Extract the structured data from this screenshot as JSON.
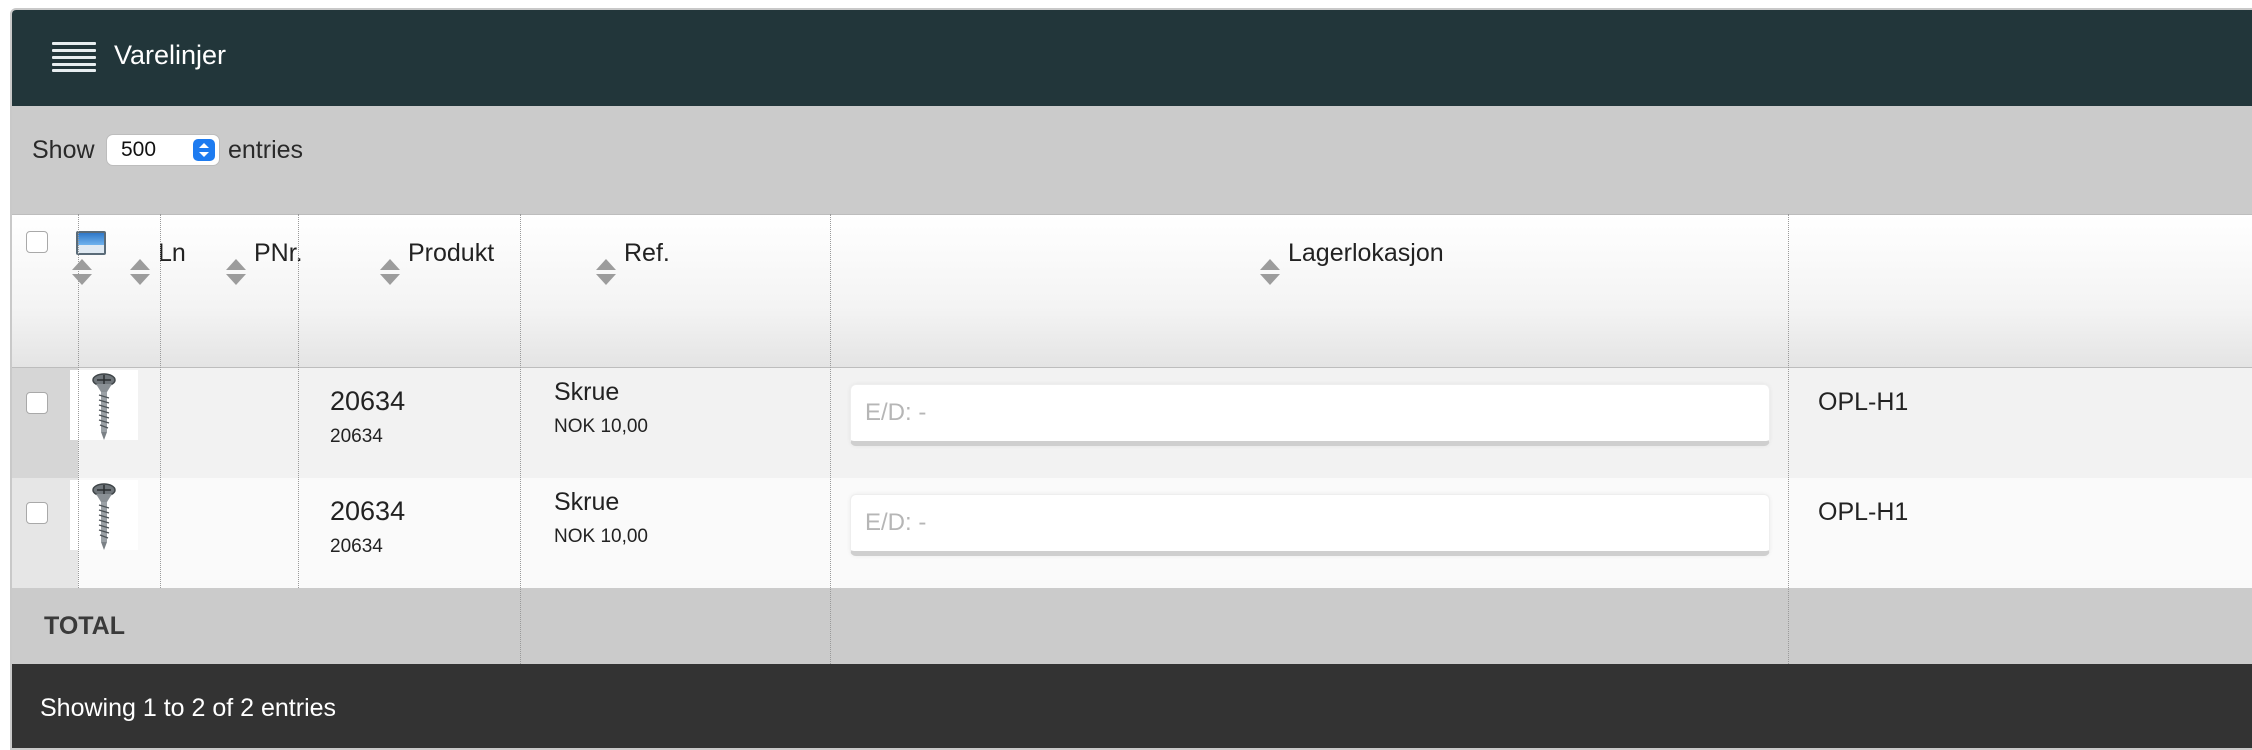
{
  "header": {
    "title": "Varelinjer",
    "menu_icon": "hamburger-menu-icon"
  },
  "toolbar": {
    "show_label": "Show",
    "entries_value": "500",
    "entries_label": "entries"
  },
  "table": {
    "columns": {
      "image_icon": "image-icon",
      "ln": "Ln",
      "pnr": "PNr.",
      "produkt": "Produkt",
      "ref": "Ref.",
      "lagerlokasjon": "Lagerlokasjon"
    },
    "rows": [
      {
        "ln": "",
        "pnr": "20634",
        "pnr_sub": "20634",
        "produkt": "Skrue",
        "price": "NOK 10,00",
        "ref_placeholder": "E/D: -",
        "lagerlokasjon": "OPL-H1"
      },
      {
        "ln": "",
        "pnr": "20634",
        "pnr_sub": "20634",
        "produkt": "Skrue",
        "price": "NOK 10,00",
        "ref_placeholder": "E/D: -",
        "lagerlokasjon": "OPL-H1"
      }
    ],
    "total_label": "TOTAL"
  },
  "footer": {
    "info": "Showing 1 to 2 of 2 entries"
  }
}
